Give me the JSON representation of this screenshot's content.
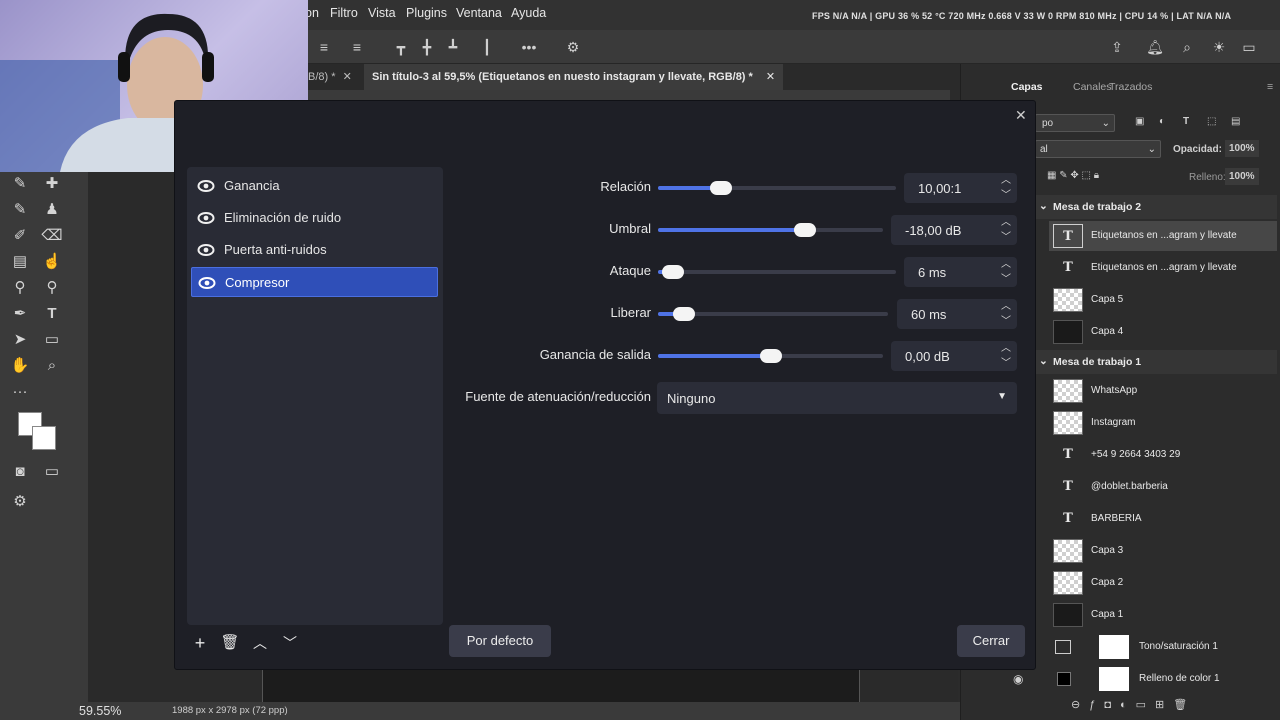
{
  "menubar": {
    "items": [
      "on",
      "Filtro",
      "Vista",
      "Plugins",
      "Ventana",
      "Ayuda"
    ],
    "perf": "FPS N/A N/A | GPU 36 % 52 °C 720 MHz 0.668 V 33 W 0 RPM 810 MHz | CPU 14 % | LAT N/A N/A"
  },
  "tabs": {
    "prev": "B/8) *",
    "active": "Sin título-3 al 59,5% (Etiquetanos en nuesto  instagram y llevate, RGB/8) *"
  },
  "status": {
    "zoom": "59.55%",
    "docsize": "1988 px x 2978 px (72 ppp)"
  },
  "panel": {
    "tabs": [
      "Capas",
      "Canales",
      "Trazados"
    ],
    "kind_partial": "po",
    "blend_partial": "al",
    "opacity_label": "Opacidad:",
    "opacity_value": "100%",
    "fill_label": "Relleno:",
    "fill_value": "100%",
    "groups": [
      "Mesa de trabajo 2",
      "Mesa de trabajo 1"
    ],
    "layers_group2": [
      "Etiquetanos en ...agram y llevate",
      "Etiquetanos en ...agram y llevate",
      "Capa 5",
      "Capa 4"
    ],
    "layers_group1": [
      "WhatsApp",
      "Instagram",
      "+54 9 2664 3403 29",
      "@doblet.barberia",
      "BARBERIA",
      "Capa 3",
      "Capa 2",
      "Capa 1",
      "Tono/saturación 1",
      "Relleno de color 1"
    ]
  },
  "dialog": {
    "filters": [
      "Ganancia",
      "Eliminación de ruido",
      "Puerta anti-ruidos",
      "Compresor"
    ],
    "selected_filter": "Compresor",
    "params": {
      "ratio": {
        "label": "Relación",
        "value": "10,00:1",
        "level": 0.24
      },
      "threshold": {
        "label": "Umbral",
        "value": "-18,00 dB",
        "level": 0.67
      },
      "attack": {
        "label": "Ataque",
        "value": "6 ms",
        "level": 0.02
      },
      "release": {
        "label": "Liberar",
        "value": "60 ms",
        "level": 0.07
      },
      "output_gain": {
        "label": "Ganancia de salida",
        "value": "0,00 dB",
        "level": 0.5
      }
    },
    "sidechain_label": "Fuente de atenuación/reducción",
    "sidechain_value": "Ninguno",
    "defaults_button": "Por defecto",
    "close_button": "Cerrar"
  }
}
